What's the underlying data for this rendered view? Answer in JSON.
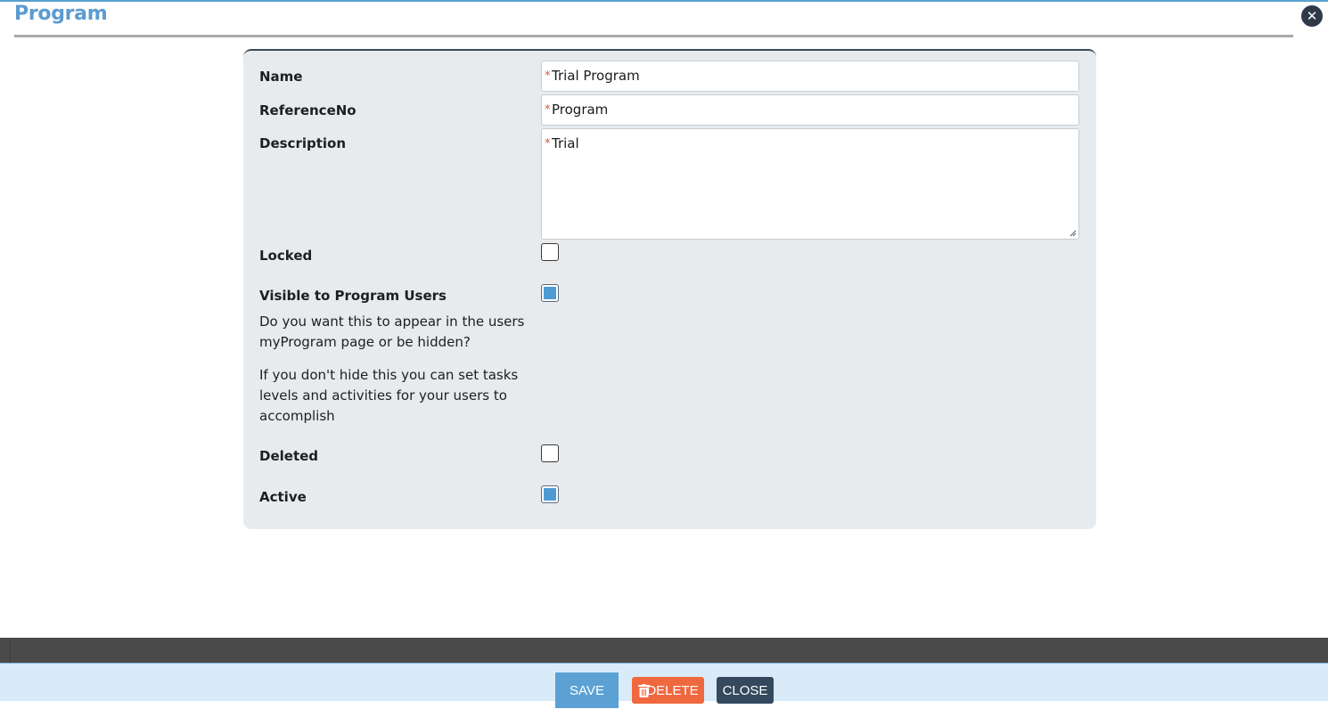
{
  "modal": {
    "title": "Program"
  },
  "form": {
    "name": {
      "label": "Name",
      "value": "Trial Program",
      "required_mark": "*"
    },
    "reference_no": {
      "label": "ReferenceNo",
      "value": "Program",
      "required_mark": "*"
    },
    "description": {
      "label": "Description",
      "value": "Trial",
      "required_mark": "*"
    },
    "locked": {
      "label": "Locked",
      "checked": false
    },
    "visible": {
      "label": "Visible to Program Users",
      "checked": true,
      "help_1": "Do you want this to appear in the users myProgram page or be hidden?",
      "help_2": "If you don't hide this you can set tasks levels and activities for your users to accomplish"
    },
    "deleted": {
      "label": "Deleted",
      "checked": false
    },
    "active": {
      "label": "Active",
      "checked": true
    }
  },
  "footer": {
    "save_label": "SAVE",
    "delete_label": "DELETE",
    "close_label": "CLOSE"
  },
  "colors": {
    "title": "#5b9bd1",
    "accent": "#5ba1d3",
    "delete": "#f0683f",
    "close": "#34495d",
    "checkbox_fill": "#4e9ad3"
  },
  "icons": {
    "close_modal": "close-icon",
    "delete": "trash-icon",
    "resize": "resize-grip-icon"
  }
}
